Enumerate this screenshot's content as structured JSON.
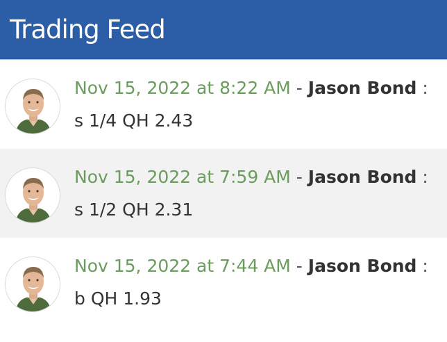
{
  "header": {
    "title": "Trading Feed"
  },
  "feed": {
    "separator": "-",
    "colon": ":",
    "entries": [
      {
        "timestamp": "Nov 15, 2022 at 8:22 AM",
        "author": "Jason Bond",
        "message": "s 1/4 QH 2.43"
      },
      {
        "timestamp": "Nov 15, 2022 at 7:59 AM",
        "author": "Jason Bond",
        "message": "s 1/2 QH 2.31"
      },
      {
        "timestamp": "Nov 15, 2022 at 7:44 AM",
        "author": "Jason Bond",
        "message": "b QH 1.93"
      }
    ]
  },
  "colors": {
    "header_bg": "#2b5ea7",
    "timestamp": "#6a9c5c",
    "alt_row_bg": "#f2f2f2"
  }
}
